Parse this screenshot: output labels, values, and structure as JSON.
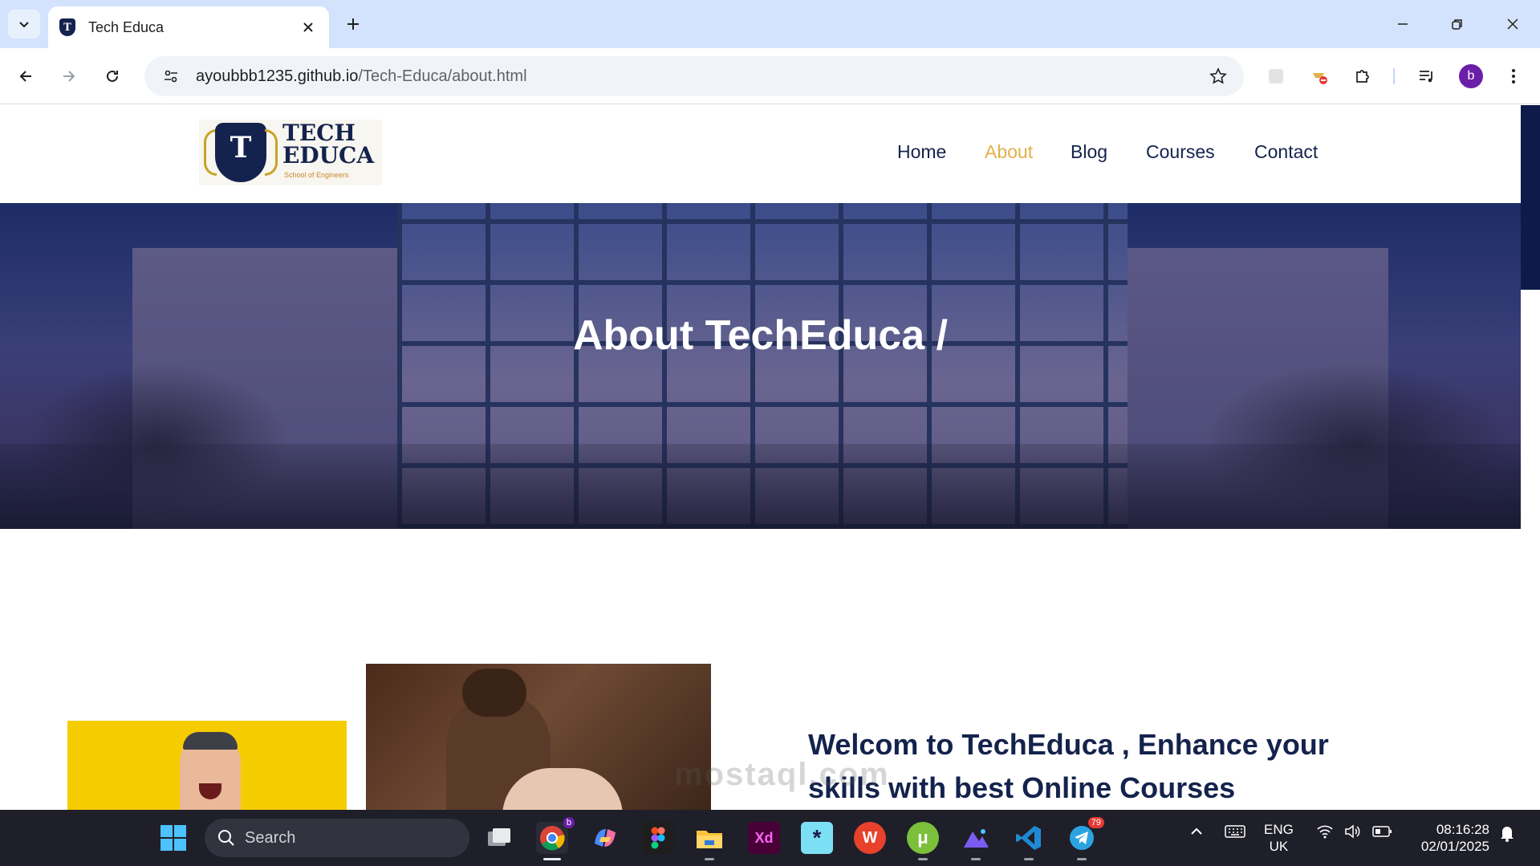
{
  "browser": {
    "tab_title": "Tech Educa",
    "url_host": "ayoubbb1235.github.io",
    "url_path": "/Tech-Educa/about.html",
    "profile_initial": "b"
  },
  "site": {
    "logo": {
      "line1": "TECH",
      "line2": "EDUCA",
      "subtitle": "School of Engineers",
      "mark": "T"
    },
    "nav": [
      {
        "label": "Home"
      },
      {
        "label": "About"
      },
      {
        "label": "Blog"
      },
      {
        "label": "Courses"
      },
      {
        "label": "Contact"
      }
    ],
    "active_nav": "About",
    "hero_title": "About TechEduca /",
    "welcome_heading": "Welcom to TechEduca , Enhance your skills with best Online Courses",
    "watermark": "mostaql.com"
  },
  "taskbar": {
    "search_label": "Search",
    "chrome_badge": "b",
    "telegram_badge": "79",
    "lang_line1": "ENG",
    "lang_line2": "UK",
    "time": "08:16:28",
    "date": "02/01/2025"
  },
  "colors": {
    "brand_navy": "#14234d",
    "accent_gold": "#e2b04a",
    "tabstrip": "#d3e3fd"
  }
}
